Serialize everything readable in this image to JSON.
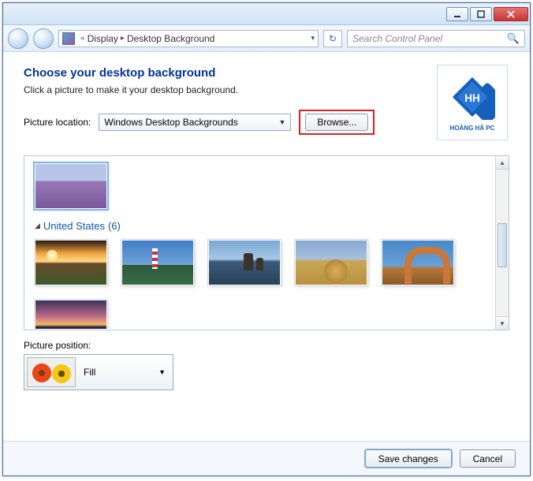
{
  "titlebar": {
    "min": "_",
    "max": "□",
    "close": "×"
  },
  "toolbar": {
    "breadcrumb_prefix": "«",
    "crumb1": "Display",
    "crumb2": "Desktop Background",
    "search_placeholder": "Search Control Panel"
  },
  "header": {
    "title": "Choose your desktop background",
    "subtitle": "Click a picture to make it your desktop background."
  },
  "location": {
    "label": "Picture location:",
    "value": "Windows Desktop Backgrounds",
    "browse": "Browse..."
  },
  "logo": {
    "text": "HOÀNG HÀ PC"
  },
  "gallery": {
    "category1": {
      "name": "United States",
      "count": "(6)"
    }
  },
  "position": {
    "label": "Picture position:",
    "value": "Fill"
  },
  "footer": {
    "save": "Save changes",
    "cancel": "Cancel"
  }
}
